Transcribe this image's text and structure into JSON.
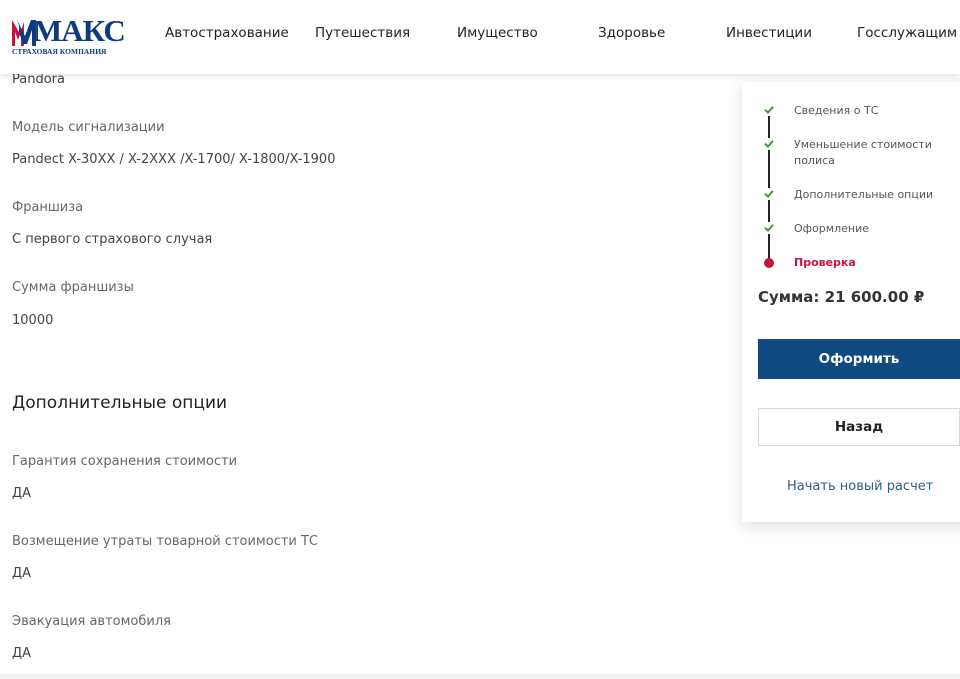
{
  "brand": {
    "logo_word": "МАКС",
    "logo_sub": "СТРАХОВАЯ КОМПАНИЯ",
    "logo_color": "#0c3c7e",
    "logo_accent": "#c8143c"
  },
  "nav": {
    "items": [
      {
        "label": "Автострахование"
      },
      {
        "label": "Путешествия"
      },
      {
        "label": "Имущество"
      },
      {
        "label": "Здоровье"
      },
      {
        "label": "Инвестиции"
      },
      {
        "label": "Госслужащим"
      }
    ]
  },
  "details": {
    "alarm_brand_value": "Pandora",
    "alarm_model_label": "Модель сигнализации",
    "alarm_model_value": "Pandect X-30XX / X-2XXX /X-1700/ X-1800/X-1900",
    "deductible_label": "Франшиза",
    "deductible_value": "С первого страхового случая",
    "deductible_sum_label": "Сумма франшизы",
    "deductible_sum_value": "10000"
  },
  "options": {
    "title": "Дополнительные опции",
    "items": [
      {
        "label": "Гарантия сохранения стоимости",
        "value": "ДА"
      },
      {
        "label": "Возмещение утраты товарной стоимости ТС",
        "value": "ДА"
      },
      {
        "label": "Эвакуация автомобиля",
        "value": "ДА"
      }
    ]
  },
  "sidebar": {
    "steps": [
      {
        "label": "Сведения о ТС",
        "status": "done"
      },
      {
        "label": "Уменьшение стоимости полиса",
        "status": "done"
      },
      {
        "label": "Дополнительные опции",
        "status": "done"
      },
      {
        "label": "Оформление",
        "status": "done"
      },
      {
        "label": "Проверка",
        "status": "active"
      }
    ],
    "sum_text": "Сумма: 21 600.00 ₽",
    "submit_label": "Оформить",
    "back_label": "Назад",
    "new_calc_label": "Начать новый расчет",
    "colors": {
      "done": "#3a9b2e",
      "active": "#c8143c",
      "primary_button": "#0f4a82",
      "link": "#2a5f8a"
    }
  }
}
